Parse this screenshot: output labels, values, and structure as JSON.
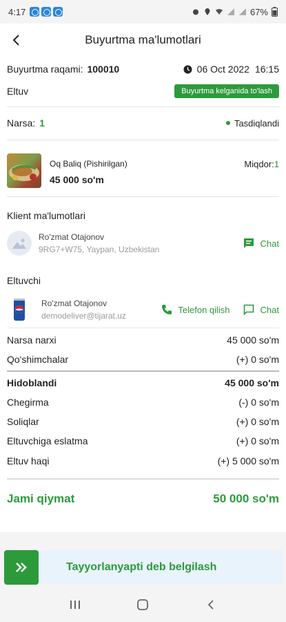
{
  "status_bar": {
    "time": "4:17",
    "battery": "67%"
  },
  "header": {
    "title": "Buyurtma ma'lumotlari"
  },
  "order": {
    "number_label": "Buyurtma raqami:",
    "number": "100010",
    "date": "06 Oct 2022",
    "time": "16:15",
    "delivery": "Eltuv",
    "payment_badge": "Buyurtma kelganida to'lash",
    "items_label": "Narsa:",
    "items_count": "1",
    "status": "Tasdiqlandi"
  },
  "product": {
    "name": "Oq Baliq (Pishirilgan)",
    "price": "45 000 so'm",
    "qty_label": "Miqdor:",
    "qty": "1"
  },
  "client": {
    "section_title": "Klient ma'lumotlari",
    "name": "Ro'zmat Otajonov",
    "address": "9RG7+W75, Yaypan, Uzbekistan",
    "chat_label": "Chat"
  },
  "courier": {
    "section_title": "Eltuvchi",
    "name": "Ro'zmat Otajonov",
    "email": "demodeliver@tijarat.uz",
    "call_label": "Telefon qilish",
    "chat_label": "Chat"
  },
  "summary": {
    "item_price_label": "Narsa narxi",
    "item_price": "45 000 so'm",
    "addons_label": "Qo'shimchalar",
    "addons": "(+) 0 so'm",
    "subtotal_label": "Hidoblandi",
    "subtotal": "45 000 so'm",
    "discount_label": "Chegirma",
    "discount": "(-) 0 so'm",
    "tax_label": "Soliqlar",
    "tax": "(+) 0 so'm",
    "tip_label": "Eltuvchiga eslatma",
    "tip": "(+) 0 so'm",
    "delivery_fee_label": "Eltuv haqi",
    "delivery_fee": "(+) 5 000 so'm",
    "total_label": "Jami qiymat",
    "total": "50 000 so'm"
  },
  "cta": {
    "label": "Tayyorlanyapti deb belgilash"
  },
  "colors": {
    "accent": "#2c9a3b",
    "cta_bg": "#e8f3fb"
  }
}
